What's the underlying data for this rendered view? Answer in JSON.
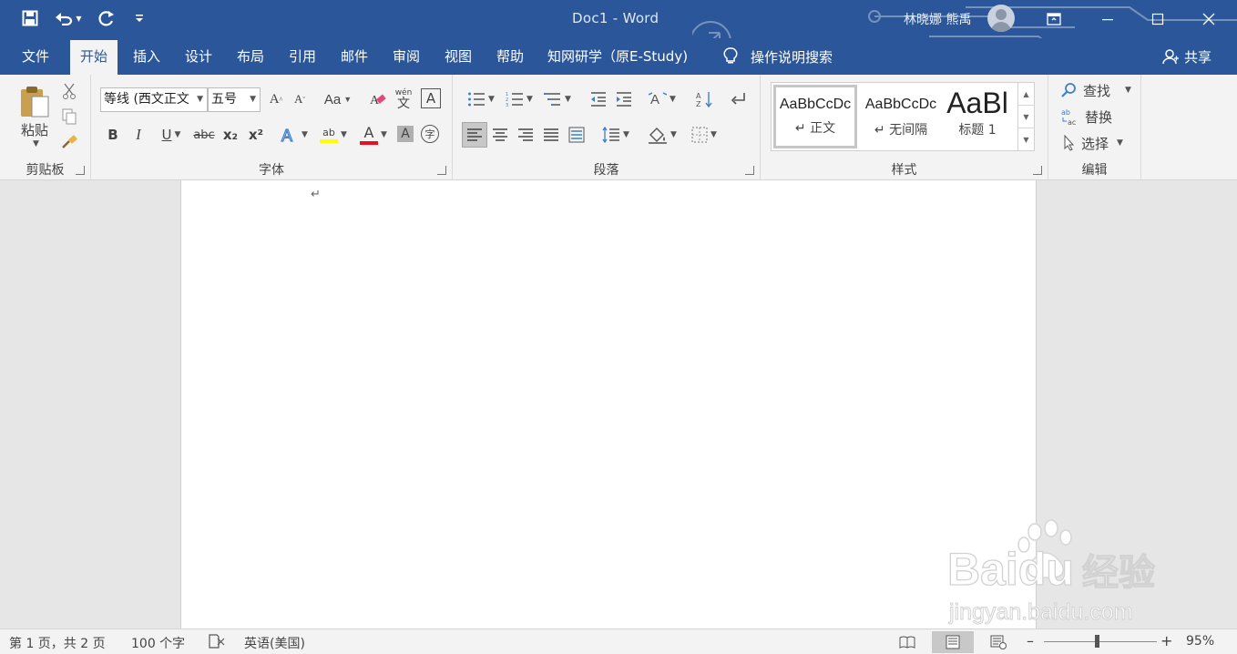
{
  "title_bar": {
    "window_title": "Doc1  -  Word",
    "user_name": "林晓娜 熊禹",
    "quick_access": [
      "save-icon",
      "undo-icon",
      "redo-icon",
      "customize-icon"
    ]
  },
  "tabs": [
    "文件",
    "开始",
    "插入",
    "设计",
    "布局",
    "引用",
    "邮件",
    "审阅",
    "视图",
    "帮助",
    "知网研学（原E-Study)"
  ],
  "active_tab": "开始",
  "tell_me": "操作说明搜索",
  "share": "共享",
  "clipboard": {
    "paste_label": "粘贴",
    "group_label": "剪贴板"
  },
  "font": {
    "font_name": "等线 (西文正文",
    "font_size": "五号",
    "group_label": "字体",
    "buttons": {
      "case_label": "Aa",
      "bold": "B",
      "italic": "I",
      "underline": "U",
      "strike": "abc",
      "subscript": "x₂",
      "superscript": "x²",
      "font_color_letter": "A",
      "highlight_label": "ab",
      "phonetic_top": "wén",
      "phonetic_bottom": "文",
      "border_char": "A",
      "shade_char": "A",
      "enclose_char": "字",
      "grow": "A",
      "shrink": "A"
    },
    "font_color": "#e81123",
    "highlight_color": "#ffff00"
  },
  "paragraph": {
    "group_label": "段落"
  },
  "styles": {
    "group_label": "样式",
    "items": [
      {
        "preview": "AaBbCcDc",
        "name": "↵ 正文"
      },
      {
        "preview": "AaBbCcDc",
        "name": "↵ 无间隔"
      },
      {
        "preview": "AaBl",
        "name": "标题 1"
      }
    ]
  },
  "editing": {
    "find": "查找",
    "replace": "替换",
    "select": "选择",
    "group_label": "编辑"
  },
  "document": {
    "paragraph_mark": "↵"
  },
  "status_bar": {
    "page_info": "第 1 页，共 2 页",
    "word_count": "100 个字",
    "language": "英语(美国)",
    "zoom_minus": "–",
    "zoom_plus": "+",
    "zoom_level": "95%"
  },
  "watermark": {
    "brand": "Baidu",
    "cn": "经验",
    "url": "jingyan.baidu.com"
  },
  "colors": {
    "title_bar": "#2b579a",
    "ribbon": "#f3f3f3",
    "canvas": "#e6e6e6"
  }
}
